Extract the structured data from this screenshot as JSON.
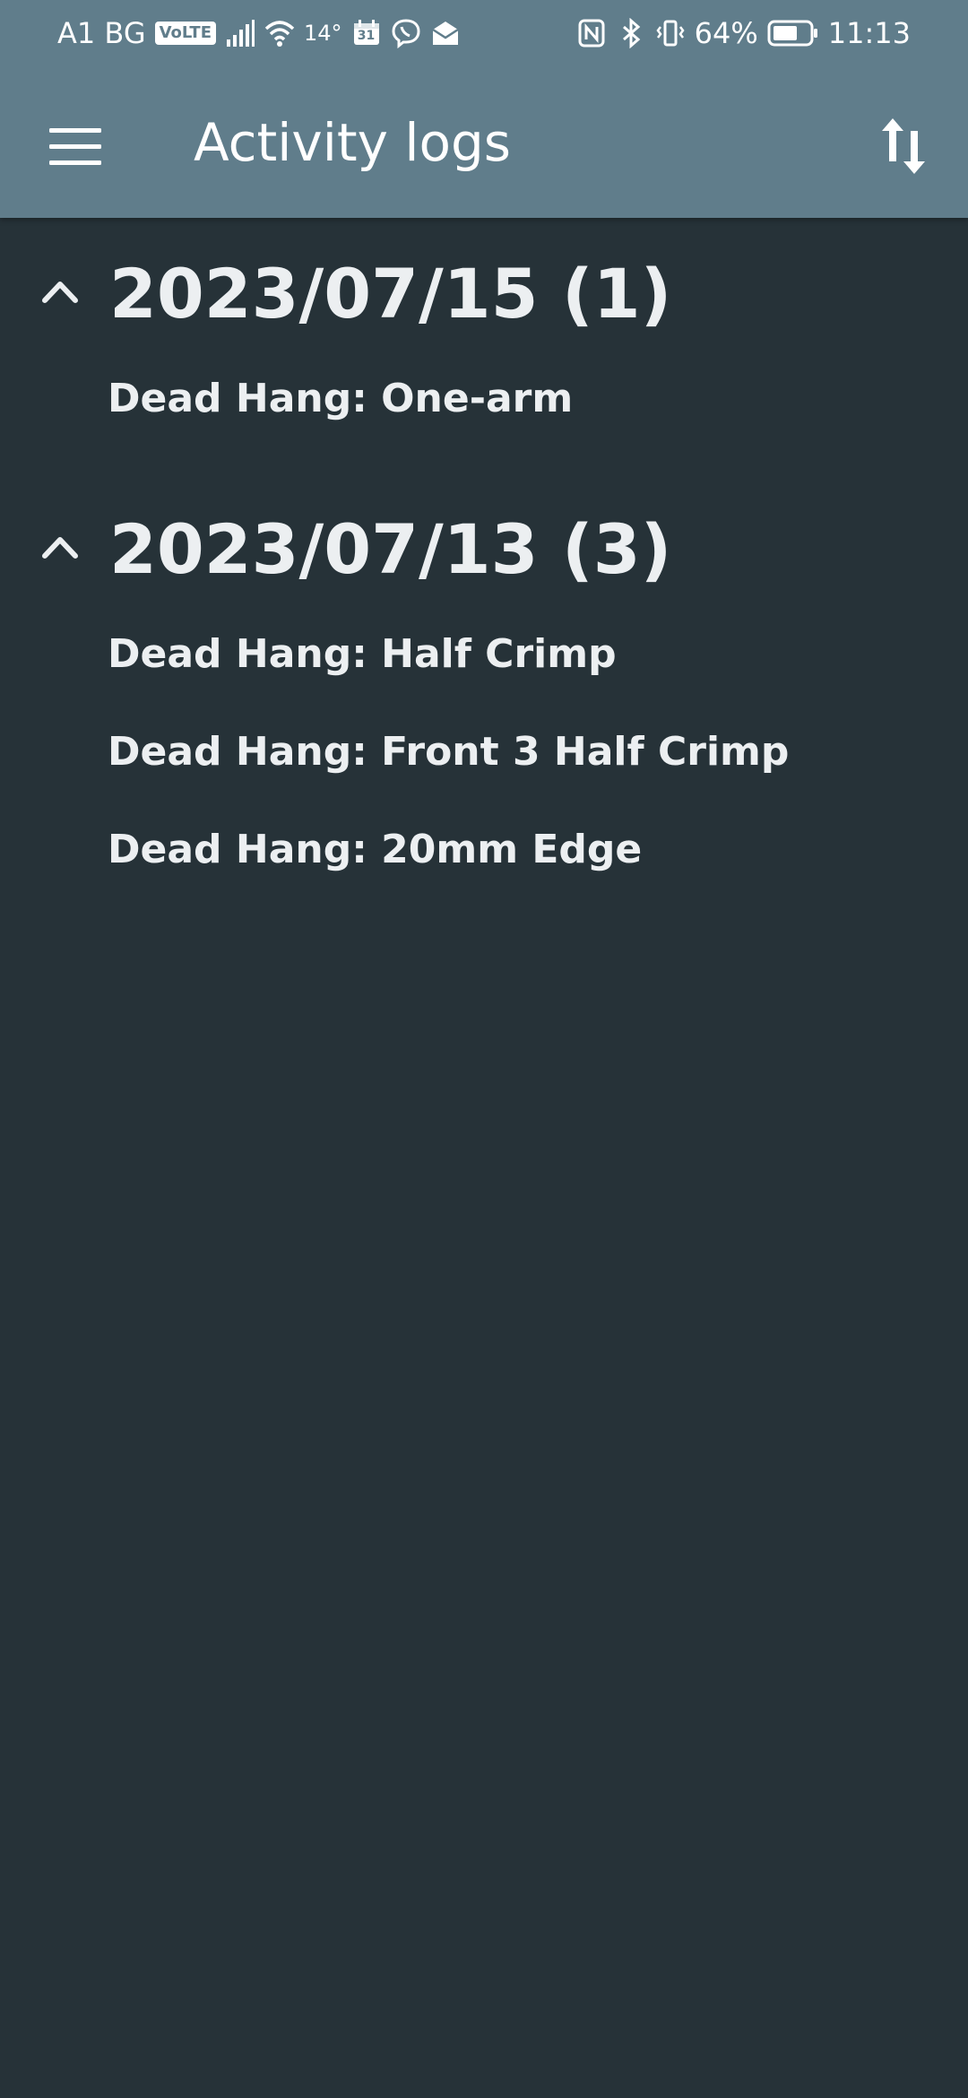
{
  "status_bar": {
    "carrier": "A1 BG",
    "volte": "VoLTE",
    "temperature": "14°",
    "calendar_day": "31",
    "battery_percent": "64%",
    "time": "11:13"
  },
  "toolbar": {
    "title": "Activity logs",
    "menu_icon": "hamburger-menu-icon",
    "sort_icon": "sort-arrows-icon"
  },
  "groups": [
    {
      "header": "2023/07/15 (1)",
      "expanded": true,
      "items": [
        "Dead Hang: One-arm"
      ]
    },
    {
      "header": "2023/07/13 (3)",
      "expanded": true,
      "items": [
        "Dead Hang: Half Crimp",
        "Dead Hang: Front 3 Half Crimp",
        "Dead Hang: 20mm Edge"
      ]
    }
  ],
  "colors": {
    "app_bar": "#607d8b",
    "background": "#263238",
    "text": "#eceff1"
  }
}
